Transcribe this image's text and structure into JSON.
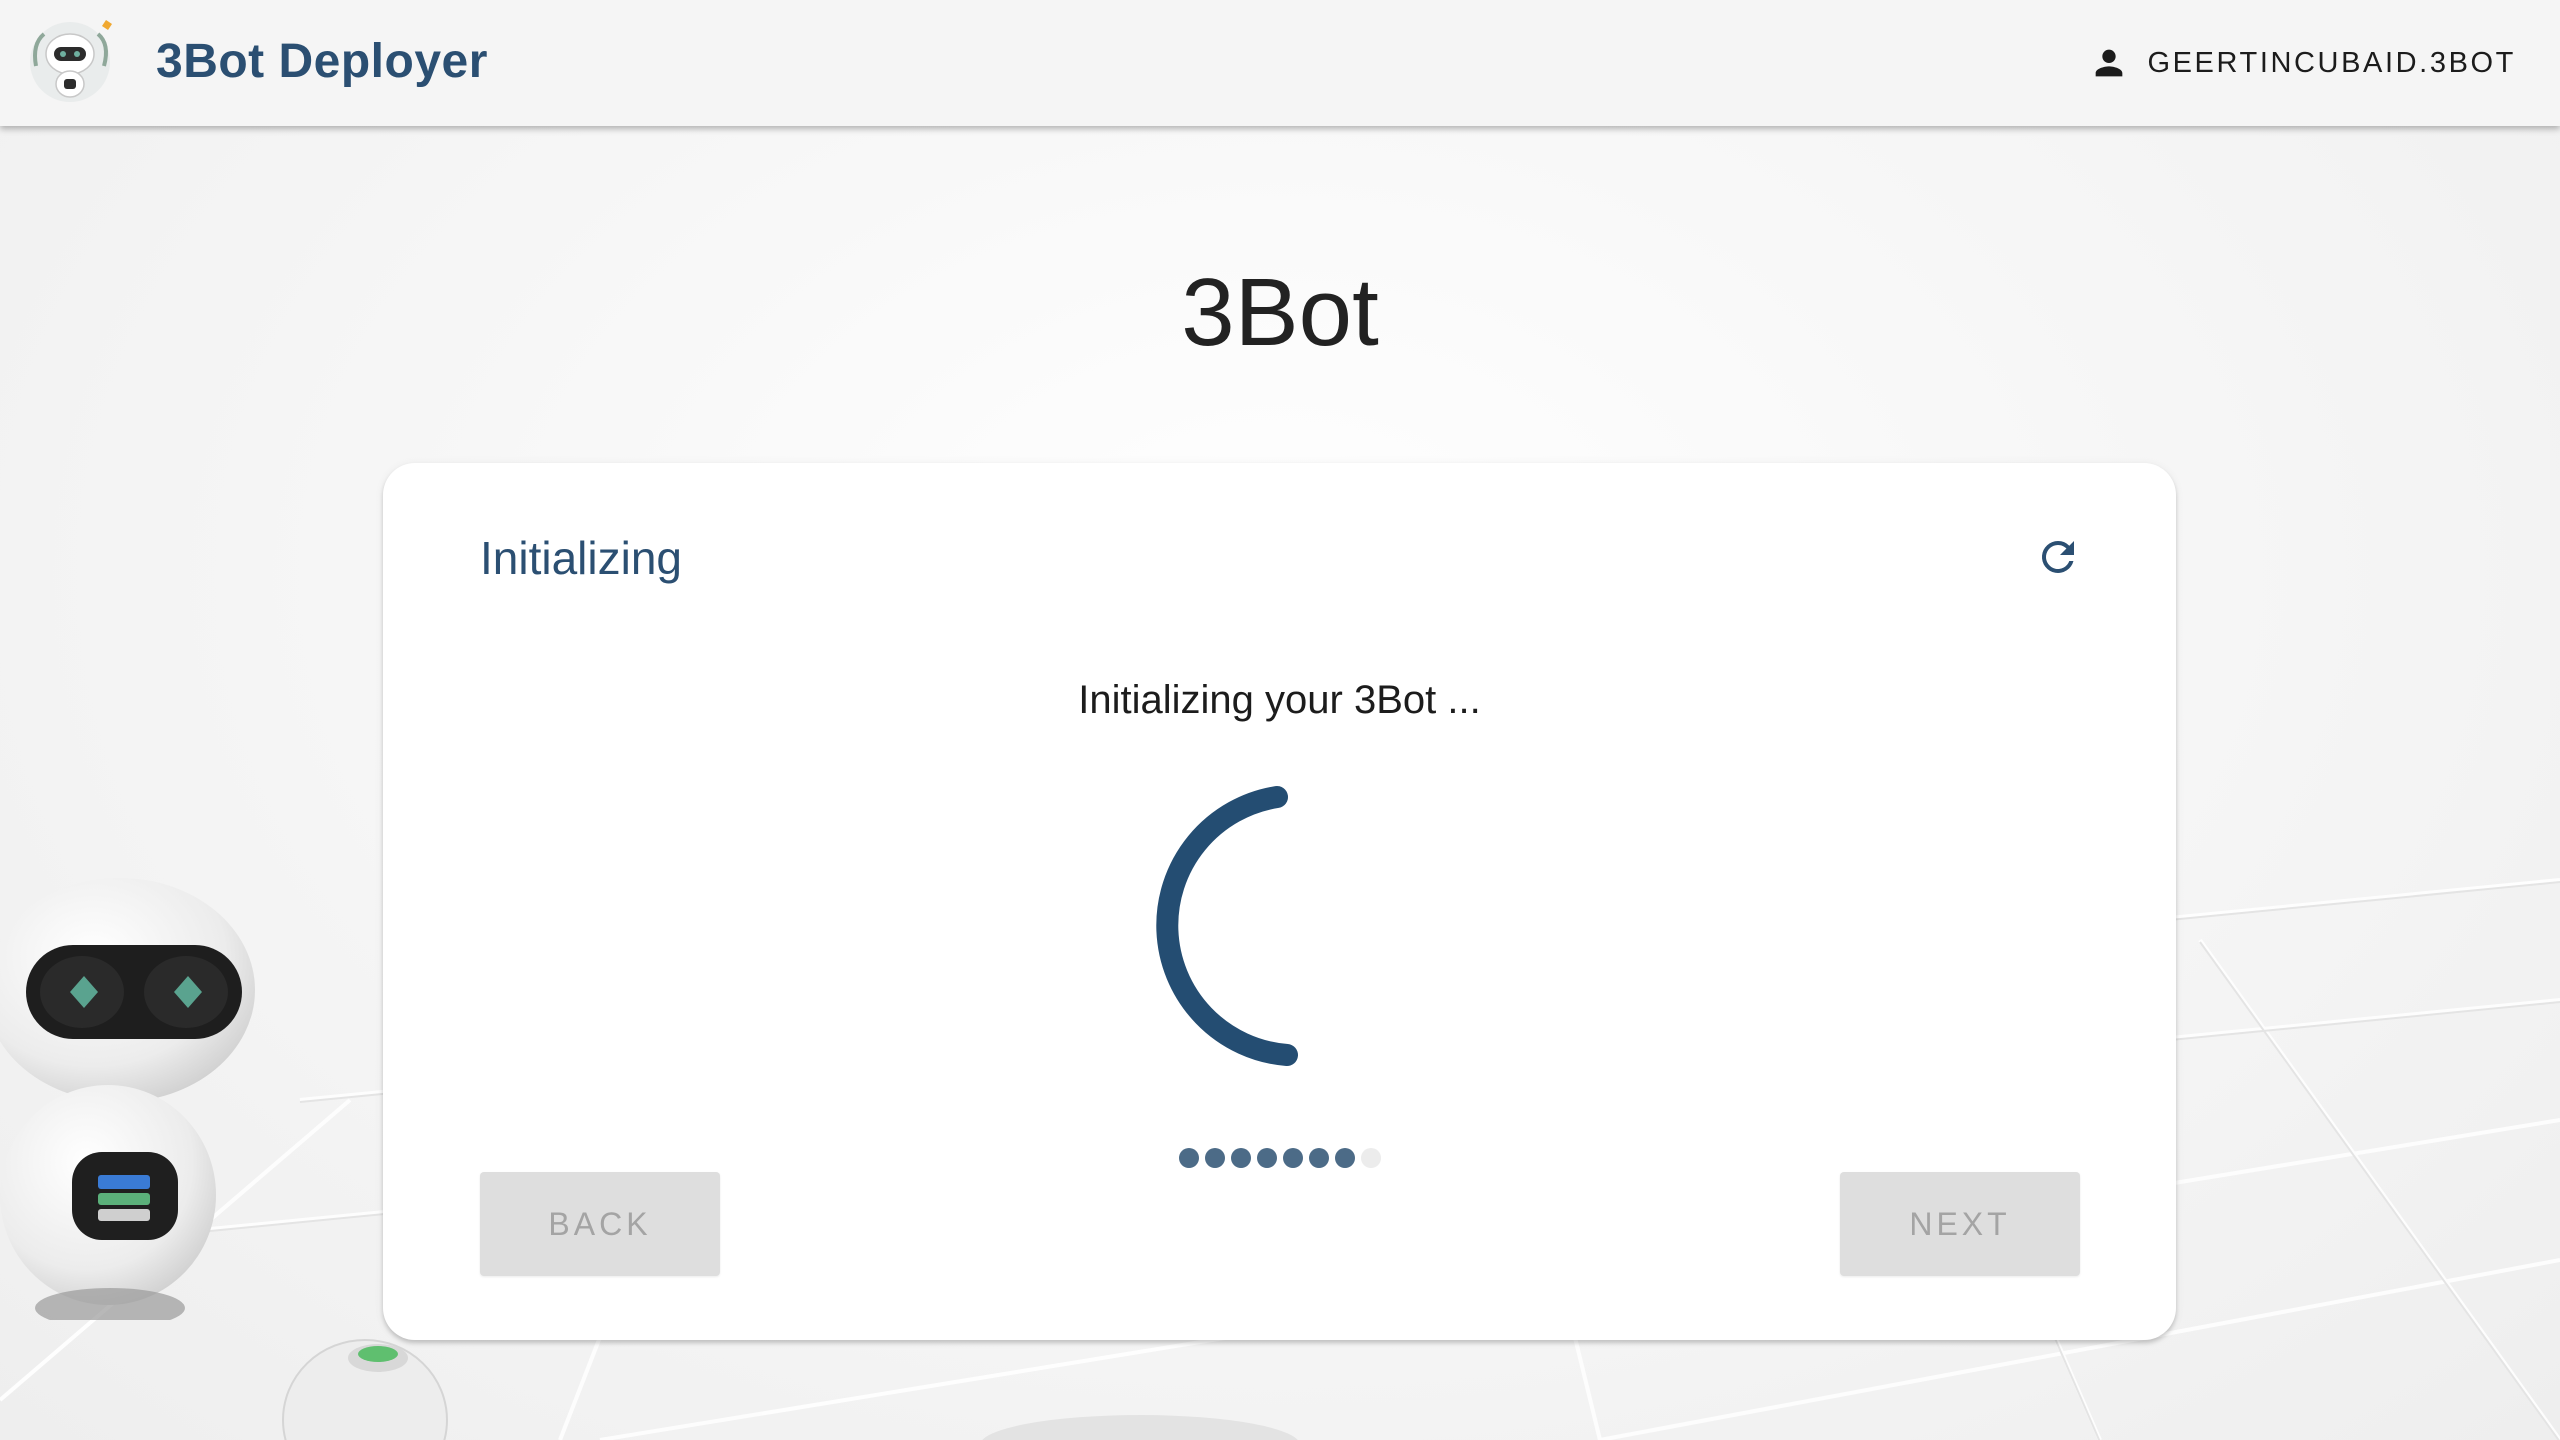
{
  "header": {
    "app_title": "3Bot Deployer",
    "user_name": "GEERTINCUBAID.3BOT",
    "logo_icon": "robot-logo-icon",
    "user_icon": "person-icon"
  },
  "page": {
    "title": "3Bot"
  },
  "card": {
    "step_title": "Initializing",
    "status_text": "Initializing your 3Bot ...",
    "refresh_icon": "refresh-icon",
    "back_label": "BACK",
    "next_label": "NEXT",
    "back_enabled": false,
    "next_enabled": false,
    "stepper": {
      "total_steps": 8,
      "completed_steps": 7
    }
  },
  "colors": {
    "brand": "#2b4f72",
    "spinner": "#244d72",
    "dot_active": "#4c6b87",
    "dot_inactive": "#ececec",
    "button_disabled_bg": "#dedede",
    "button_disabled_text": "#a4a4a4"
  }
}
